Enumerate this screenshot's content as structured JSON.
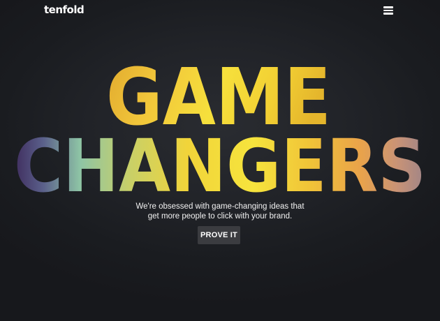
{
  "header": {
    "logo_text": "tenfold",
    "menu_icon": "hamburger-menu-icon"
  },
  "hero": {
    "headline_line1": "GAME",
    "headline_line2": "CHANGERS",
    "tagline_line1": "We're obsessed with game-changing ideas that",
    "tagline_line2": "get more people to click with your brand.",
    "cta_label": "PROVE IT"
  },
  "colors": {
    "background": "#1b1d22",
    "text": "#ffffff",
    "button_bg": "#3b3c40",
    "headline_gold": "#f2c633",
    "headline_yellow": "#f6e23a",
    "headline_teal": "#8fc5a6",
    "headline_purple": "#4a3366"
  }
}
